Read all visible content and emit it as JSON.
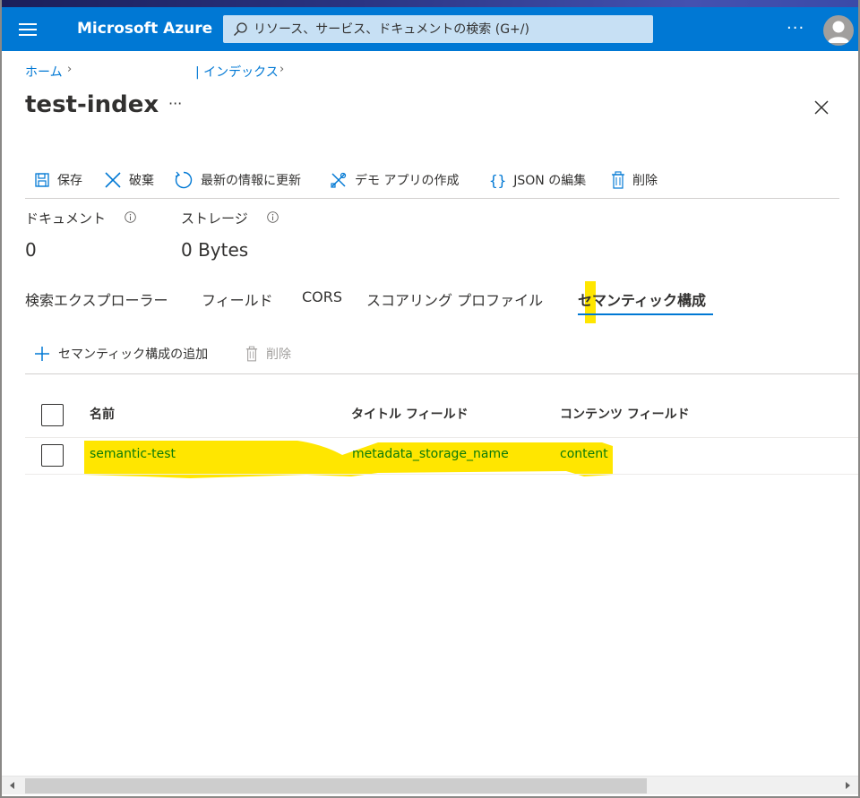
{
  "header": {
    "brand": "Microsoft Azure",
    "search_placeholder": "リソース、サービス、ドキュメントの検索 (G+/)",
    "more": "···"
  },
  "breadcrumb": {
    "items": [
      "ホーム",
      "| インデックス"
    ]
  },
  "page": {
    "title": "test-index",
    "title_more": "···"
  },
  "toolbar": {
    "save": "保存",
    "discard": "破棄",
    "refresh": "最新の情報に更新",
    "create_demo": "デモ アプリの作成",
    "edit_json": "JSON の編集",
    "delete": "削除"
  },
  "stats": [
    {
      "label": "ドキュメント",
      "value": "0"
    },
    {
      "label": "ストレージ",
      "value": "0 Bytes"
    }
  ],
  "tabs": [
    {
      "label": "検索エクスプローラー"
    },
    {
      "label": "フィールド"
    },
    {
      "label": "CORS"
    },
    {
      "label": "スコアリング プロファイル"
    },
    {
      "label": "セマンティック構成",
      "active": true
    }
  ],
  "commands": {
    "add": "セマンティック構成の追加",
    "delete": "削除"
  },
  "table": {
    "columns": [
      "名前",
      "タイトル フィールド",
      "コンテンツ フィールド"
    ],
    "rows": [
      {
        "name": "semantic-test",
        "title_field": "metadata_storage_name",
        "content_field": "content"
      }
    ]
  },
  "colors": {
    "accent": "#0078d4",
    "highlight": "#ffe600",
    "link_green": "#0a7a0a"
  }
}
